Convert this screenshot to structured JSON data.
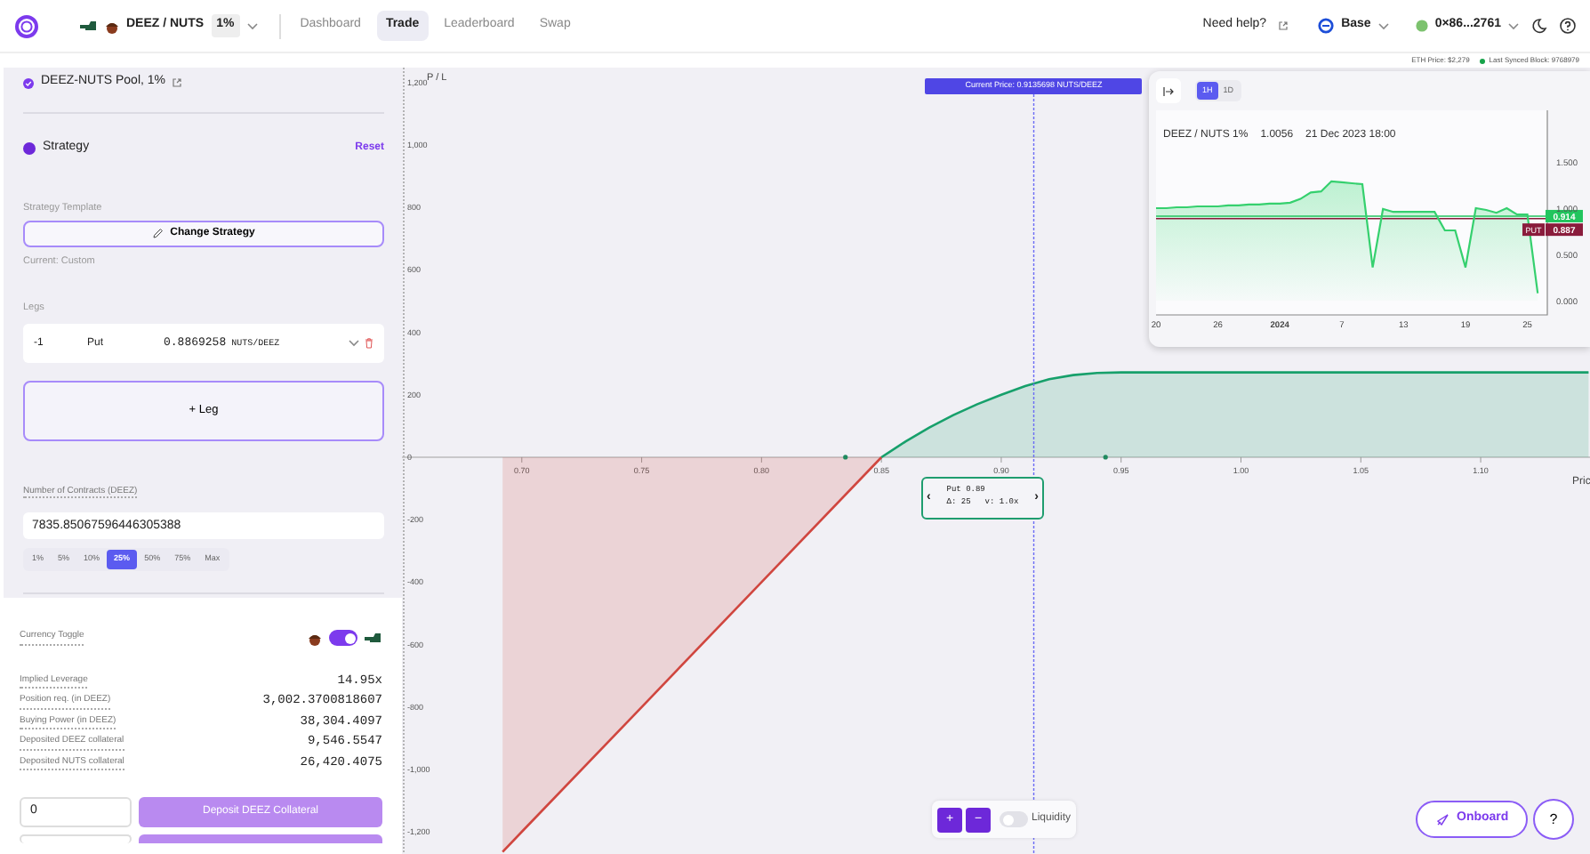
{
  "nav": {
    "pair": "DEEZ / NUTS",
    "fee": "1%",
    "links": [
      {
        "label": "Dashboard",
        "selected": false
      },
      {
        "label": "Trade",
        "selected": true
      },
      {
        "label": "Leaderboard",
        "selected": false
      },
      {
        "label": "Swap",
        "selected": false
      }
    ],
    "help": "Need help?",
    "network": "Base",
    "wallet": "0×86...2761"
  },
  "status_bar": {
    "eth_price": "ETH Price: $2,279",
    "block": "Last Synced Block: 9768979"
  },
  "sidebar": {
    "pool": "DEEZ-NUTS Pool, 1%",
    "strategy": {
      "title": "Strategy",
      "reset": "Reset",
      "template_label": "Strategy Template",
      "change_button": "Change Strategy",
      "current": "Current: Custom"
    },
    "legs": {
      "label": "Legs",
      "items": [
        {
          "qty": "-1",
          "type": "Put",
          "strike": "0.8869258",
          "unit": "NUTS/DEEZ"
        }
      ],
      "add_button": "+ Leg"
    },
    "contracts": {
      "label": "Number of Contracts (DEEZ)",
      "value": "7835.85067596446305388",
      "presets": [
        {
          "label": "1%",
          "selected": false
        },
        {
          "label": "5%",
          "selected": false
        },
        {
          "label": "10%",
          "selected": false
        },
        {
          "label": "25%",
          "selected": true
        },
        {
          "label": "50%",
          "selected": false
        },
        {
          "label": "75%",
          "selected": false
        },
        {
          "label": "Max",
          "selected": false
        }
      ]
    },
    "currency_toggle": {
      "label": "Currency Toggle",
      "on": true
    },
    "stats": [
      {
        "label": "Implied Leverage",
        "value": "14.95x"
      },
      {
        "label": "Position req. (in DEEZ)",
        "value": "3,002.3700818607"
      },
      {
        "label": "Buying Power (in DEEZ)",
        "value": "38,304.4097"
      },
      {
        "label": "Deposited DEEZ collateral",
        "value": "9,546.5547"
      },
      {
        "label": "Deposited NUTS collateral",
        "value": "26,420.4075"
      }
    ],
    "deposit": {
      "value": "0",
      "button": "Deposit DEEZ Collateral"
    }
  },
  "payoff": {
    "chart_data": {
      "type": "area",
      "ylabel": "P / L",
      "xlabel": "Pric",
      "xlim": [
        0.65,
        1.1456
      ],
      "ylim": [
        -1271,
        1248
      ],
      "x": [
        0.692,
        0.7,
        0.75,
        0.8,
        0.85,
        0.86,
        0.87,
        0.88,
        0.89,
        0.9,
        0.91,
        0.92,
        0.93,
        0.94,
        0.95,
        1.0,
        1.05,
        1.1,
        1.145
      ],
      "series": [
        {
          "color": "#d0463f",
          "values": [
            -1264,
            -1200,
            -800,
            -400,
            0,
            null,
            null,
            null,
            null,
            null,
            null,
            null,
            null,
            null,
            null,
            null,
            null,
            null,
            null
          ]
        },
        {
          "color": "#17a06b",
          "values": [
            null,
            null,
            null,
            null,
            0,
            50,
            95,
            135,
            170,
            200,
            228,
            250,
            263,
            270,
            272,
            272,
            272,
            272,
            272
          ]
        }
      ],
      "xticks": [
        {
          "value": 0.7,
          "label": "0.70"
        },
        {
          "value": 0.75,
          "label": "0.75"
        },
        {
          "value": 0.8,
          "label": "0.80"
        },
        {
          "value": 0.85,
          "label": "0.85"
        },
        {
          "value": 0.9,
          "label": "0.90"
        },
        {
          "value": 0.95,
          "label": "0.95"
        },
        {
          "value": 1.0,
          "label": "1.00"
        },
        {
          "value": 1.05,
          "label": "1.05"
        },
        {
          "value": 1.1,
          "label": "1.10"
        }
      ],
      "yticks": [
        {
          "value": 1200,
          "label": "1,200"
        },
        {
          "value": 1000,
          "label": "1,000"
        },
        {
          "value": 800,
          "label": "800"
        },
        {
          "value": 600,
          "label": "600"
        },
        {
          "value": 400,
          "label": "400"
        },
        {
          "value": 200,
          "label": "200"
        },
        {
          "value": 0,
          "label": "0"
        },
        {
          "value": -200,
          "label": "-200"
        },
        {
          "value": -400,
          "label": "-400"
        },
        {
          "value": -600,
          "label": "-600"
        },
        {
          "value": -800,
          "label": "-800"
        },
        {
          "value": -1000,
          "label": "-1,000"
        },
        {
          "value": -1200,
          "label": "-1,200"
        }
      ],
      "ref_lines": [
        {
          "axis": "x",
          "value": 0.9135698,
          "label": "Current Price: 0.9135698 NUTS/DEEZ"
        }
      ]
    },
    "tooltip": {
      "prev": "‹",
      "next": "›",
      "title": "Put 0.89",
      "delta": "Δ: 25",
      "vol": "v: 1.0x"
    }
  },
  "price_chart": {
    "intervals": [
      {
        "label": "1H",
        "selected": true
      },
      {
        "label": "1D",
        "selected": false
      }
    ],
    "title": "DEEZ / NUTS 1%",
    "price": "1.0056",
    "date": "21 Dec 2023 18:00",
    "put_tag": "PUT",
    "chart_data": {
      "type": "area",
      "ylim": [
        -0.154,
        2.058
      ],
      "categories": [
        "20",
        null,
        null,
        null,
        null,
        null,
        "26",
        null,
        null,
        null,
        null,
        null,
        "2024",
        null,
        null,
        null,
        null,
        null,
        "7",
        null,
        null,
        null,
        null,
        null,
        "13",
        null,
        null,
        null,
        null,
        null,
        "19",
        null,
        null,
        null,
        null,
        null,
        "25",
        null
      ],
      "values": [
        1.0,
        1.0,
        1.01,
        1.01,
        1.02,
        1.02,
        1.02,
        1.03,
        1.03,
        1.04,
        1.04,
        1.05,
        1.05,
        1.06,
        1.1,
        1.17,
        1.18,
        1.29,
        1.28,
        1.27,
        1.26,
        0.36,
        0.99,
        0.96,
        0.96,
        0.96,
        0.96,
        0.96,
        0.76,
        0.76,
        0.36,
        1.0,
        0.98,
        0.95,
        1.0,
        0.93,
        0.93,
        0.08
      ],
      "yticks": [
        {
          "value": 0,
          "label": "0.000"
        },
        {
          "value": 0.5,
          "label": "0.500"
        },
        {
          "value": 1,
          "label": "1.000"
        },
        {
          "value": 1.5,
          "label": "1.500"
        }
      ],
      "ref_lines": [
        {
          "axis": "y",
          "value": 0.914,
          "label": "0.914",
          "color": "#22c55e"
        },
        {
          "axis": "y",
          "value": 0.887,
          "label": "0.887",
          "color": "#8a1c3c"
        }
      ]
    }
  },
  "chart_controls": {
    "zoom_in": "+",
    "zoom_out": "−",
    "liquidity": {
      "label": "Liquidity",
      "on": false
    }
  },
  "onboard": "Onboard",
  "help_button": "?"
}
